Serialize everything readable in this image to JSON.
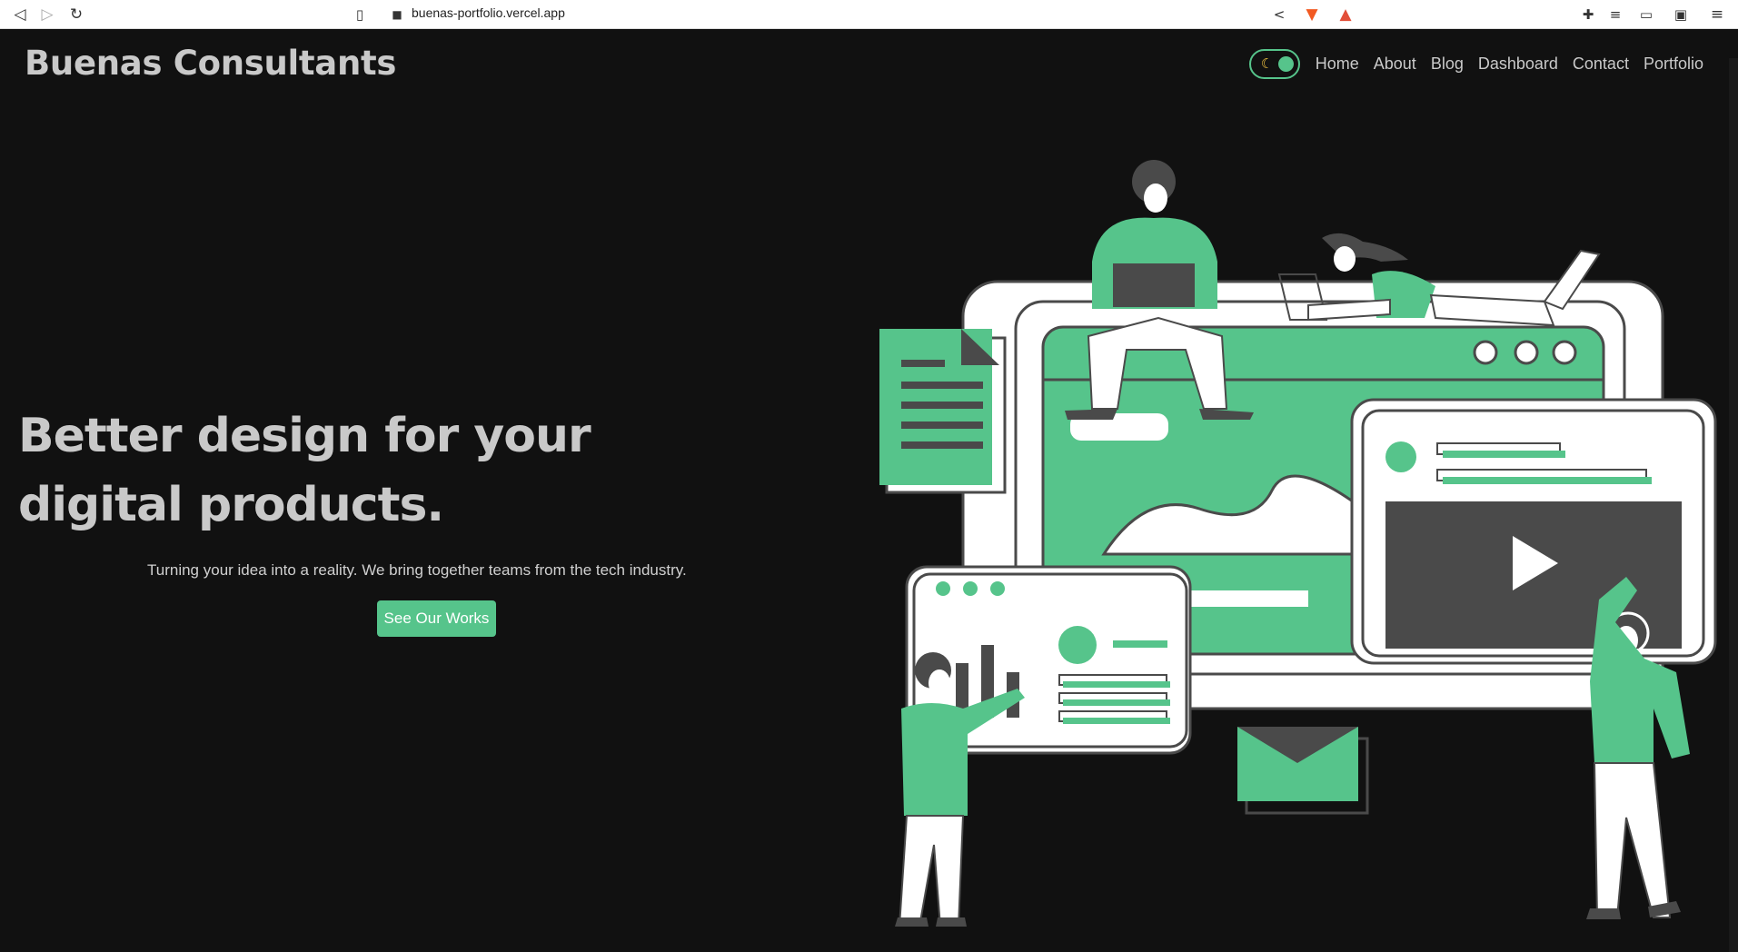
{
  "browser": {
    "url": "buenas-portfolio.vercel.app"
  },
  "header": {
    "brand": "Buenas Consultants",
    "nav": [
      "Home",
      "About",
      "Blog",
      "Dashboard",
      "Contact",
      "Portfolio"
    ]
  },
  "hero": {
    "title": "Better design for your digital products.",
    "subtitle": "Turning your idea into a reality. We bring together teams from the tech industry.",
    "cta_label": "See Our Works"
  },
  "colors": {
    "accent": "#56c48b",
    "background": "#111111",
    "text": "#c9c9c9",
    "illustration_dark": "#4a4a4a"
  }
}
